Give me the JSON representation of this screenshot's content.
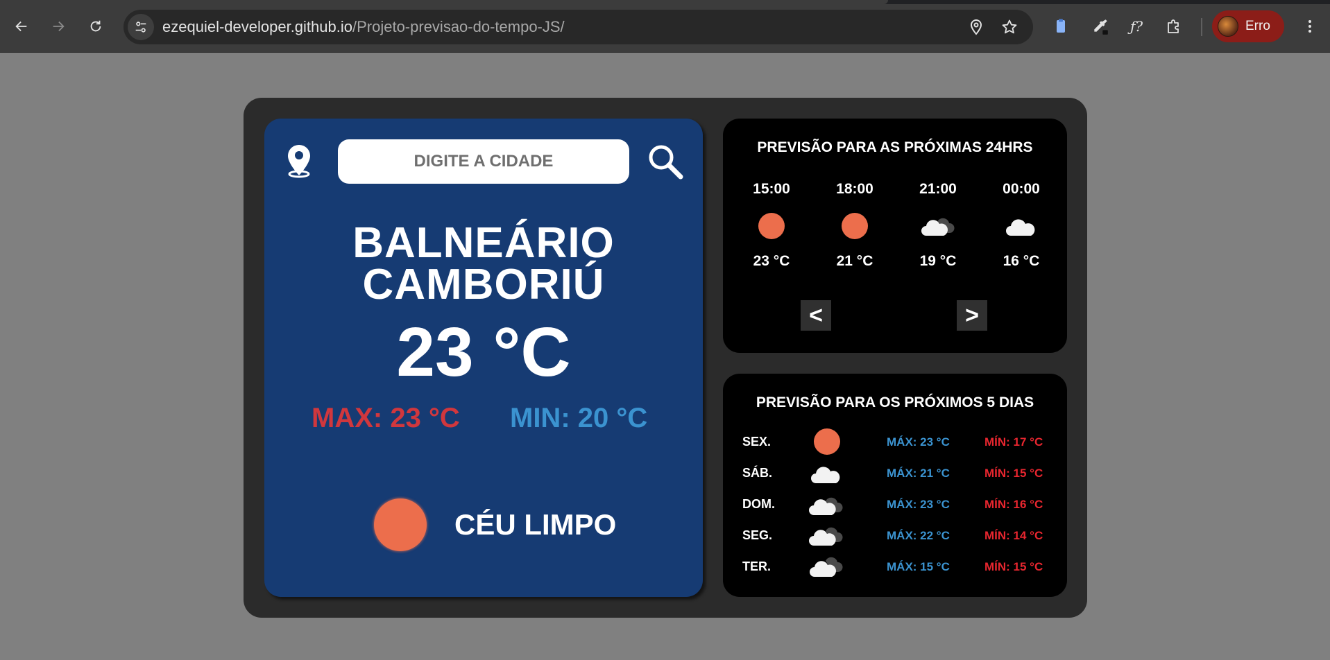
{
  "browser": {
    "url_host": "ezequiel-developer.github.io",
    "url_path": "/Projeto-previsao-do-tempo-JS/",
    "profile_label": "Erro"
  },
  "weather": {
    "search": {
      "placeholder": "DIGITE A CIDADE"
    },
    "city_line1": "BALNEÁRIO",
    "city_line2": "CAMBORIÚ",
    "temp_now": "23 °C",
    "temp_max": "MAX: 23 °C",
    "temp_min": "MIN: 20 °C",
    "condition_icon": "sun-icon",
    "condition_label": "CÉU LIMPO"
  },
  "hourly": {
    "title": "PREVISÃO PARA AS PRÓXIMAS 24HRS",
    "items": [
      {
        "time": "15:00",
        "icon": "sun-icon",
        "temp": "23 °C"
      },
      {
        "time": "18:00",
        "icon": "sun-icon",
        "temp": "21 °C"
      },
      {
        "time": "21:00",
        "icon": "cloud-with-dark-cloud-icon",
        "temp": "19 °C"
      },
      {
        "time": "00:00",
        "icon": "cloud-icon",
        "temp": "16 °C"
      }
    ],
    "prev_label": "<",
    "next_label": ">"
  },
  "daily": {
    "title": "PREVISÃO PARA OS PRÓXIMOS 5 DIAS",
    "items": [
      {
        "day": "SEX.",
        "icon": "sun-icon",
        "max": "MÁX: 23 °C",
        "min": "MÍN: 17 °C"
      },
      {
        "day": "SÁB.",
        "icon": "cloud-icon",
        "max": "MÁX: 21 °C",
        "min": "MÍN: 15 °C"
      },
      {
        "day": "DOM.",
        "icon": "clouds-icon",
        "max": "MÁX: 23 °C",
        "min": "MÍN: 16 °C"
      },
      {
        "day": "SEG.",
        "icon": "clouds-icon",
        "max": "MÁX: 22 °C",
        "min": "MÍN: 14 °C"
      },
      {
        "day": "TER.",
        "icon": "cloud-with-dark-cloud-icon",
        "max": "MÁX: 15 °C",
        "min": "MÍN: 15 °C"
      }
    ]
  },
  "colors": {
    "card_blue": "#163b73",
    "max_red": "#d1373d",
    "min_blue": "#3b93d0",
    "sun_orange": "#ec6e4c",
    "daily_min_red": "#e8262f"
  }
}
